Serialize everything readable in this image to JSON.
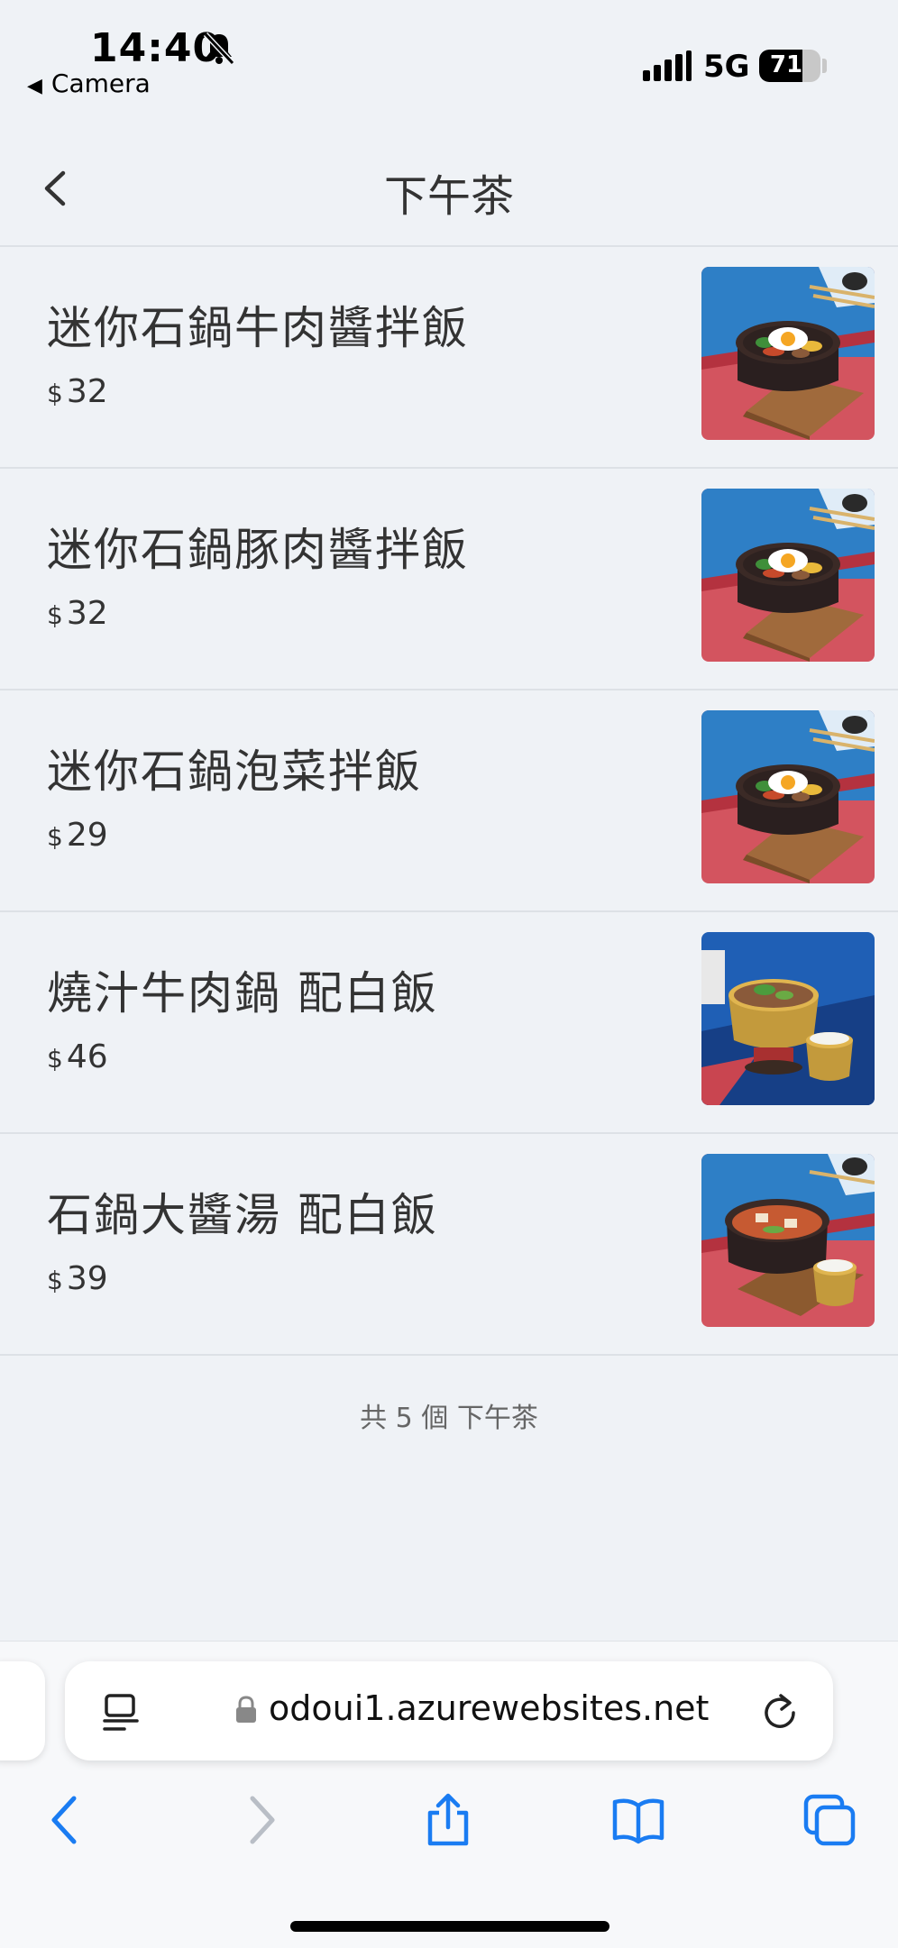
{
  "status_bar": {
    "time": "14:40",
    "back_app": "Camera",
    "network": "5G",
    "battery": "71",
    "battery_level": 0.71
  },
  "header": {
    "title": "下午茶"
  },
  "items": [
    {
      "name": "迷你石鍋牛肉醬拌飯",
      "currency": "$",
      "price": "32",
      "photo": "bibimbap-stone-pot"
    },
    {
      "name": "迷你石鍋豚肉醬拌飯",
      "currency": "$",
      "price": "32",
      "photo": "bibimbap-stone-pot"
    },
    {
      "name": "迷你石鍋泡菜拌飯",
      "currency": "$",
      "price": "29",
      "photo": "bibimbap-stone-pot"
    },
    {
      "name": "燒汁牛肉鍋 配白飯",
      "currency": "$",
      "price": "46",
      "photo": "beef-hotpot-with-rice"
    },
    {
      "name": "石鍋大醬湯 配白飯",
      "currency": "$",
      "price": "39",
      "photo": "soybean-stew-with-rice"
    }
  ],
  "summary": "共 5 個 下午茶",
  "browser": {
    "url": "odoui1.azurewebsites.net",
    "accent": "#1a7cf2"
  }
}
